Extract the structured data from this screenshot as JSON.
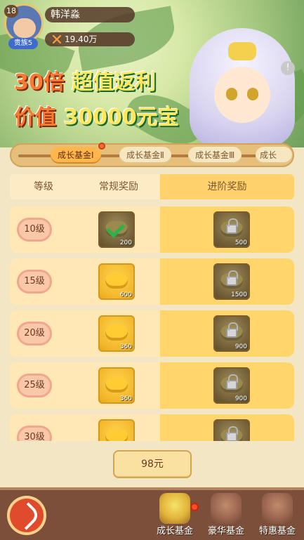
{
  "player": {
    "level": "18",
    "name": "韩洋淼",
    "vip": "贵族5",
    "power": "19.40万"
  },
  "promo": {
    "line1_prefix": "30倍",
    "line1_highlight": "超值返利",
    "line2_prefix": "价值",
    "line2_highlight": "30000元宝",
    "info_glyph": "!"
  },
  "tabs": [
    {
      "label": "成长基金Ⅰ",
      "active": true,
      "dot": true
    },
    {
      "label": "成长基金Ⅱ",
      "active": false
    },
    {
      "label": "成长基金Ⅲ",
      "active": false
    },
    {
      "label": "成长",
      "active": false
    }
  ],
  "table": {
    "headers": {
      "level": "等级",
      "normal": "常规奖励",
      "advanced": "进阶奖励"
    },
    "rows": [
      {
        "level": "10级",
        "normal": {
          "count": "200",
          "claimed": true,
          "type": "dark"
        },
        "advanced": {
          "count": "500",
          "locked": true,
          "type": "dark"
        }
      },
      {
        "level": "15级",
        "normal": {
          "count": "600",
          "claimed": false,
          "type": "gold"
        },
        "advanced": {
          "count": "1500",
          "locked": true,
          "type": "dark"
        }
      },
      {
        "level": "20级",
        "normal": {
          "count": "360",
          "claimed": false,
          "type": "gold"
        },
        "advanced": {
          "count": "900",
          "locked": true,
          "type": "dark"
        }
      },
      {
        "level": "25级",
        "normal": {
          "count": "360",
          "claimed": false,
          "type": "gold"
        },
        "advanced": {
          "count": "900",
          "locked": true,
          "type": "dark"
        }
      },
      {
        "level": "30级",
        "normal": {
          "count": "",
          "claimed": false,
          "type": "gold"
        },
        "advanced": {
          "count": "",
          "locked": true,
          "type": "dark"
        }
      }
    ]
  },
  "price_button": "98元",
  "bottom_nav": [
    {
      "label": "成长基金",
      "icon": "trophy-icon",
      "dot": true
    },
    {
      "label": "豪华基金",
      "icon": "treasure-icon"
    },
    {
      "label": "特惠基金",
      "icon": "treasure-icon"
    }
  ],
  "colors": {
    "accent": "#ff7a2e",
    "gold": "#ffd56c",
    "bottom_bar": "#7c4f3a"
  }
}
